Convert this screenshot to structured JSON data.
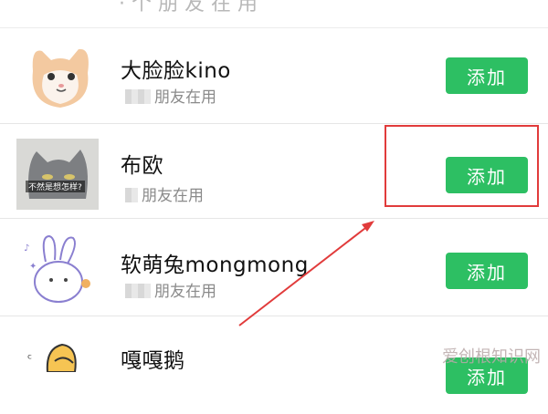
{
  "list": {
    "top_fragment_text": "· 个 朋 友 在 用",
    "items": [
      {
        "name": "大脸脸kino",
        "subtext": "朋友在用",
        "button": "添加"
      },
      {
        "name": "布欧",
        "subtext": "朋友在用",
        "button": "添加",
        "meme_caption": "不然是想怎样?"
      },
      {
        "name": "软萌兔mongmong",
        "subtext": "朋友在用",
        "button": "添加"
      },
      {
        "name": "嘎嘎鹅",
        "subtext": "",
        "button": "添加"
      }
    ]
  },
  "overlay": {
    "watermark": "爱创根知识网",
    "annotation_color": "#e13b3b"
  },
  "colors": {
    "add_button": "#2dbf63",
    "subtext": "#8a8a8a"
  }
}
